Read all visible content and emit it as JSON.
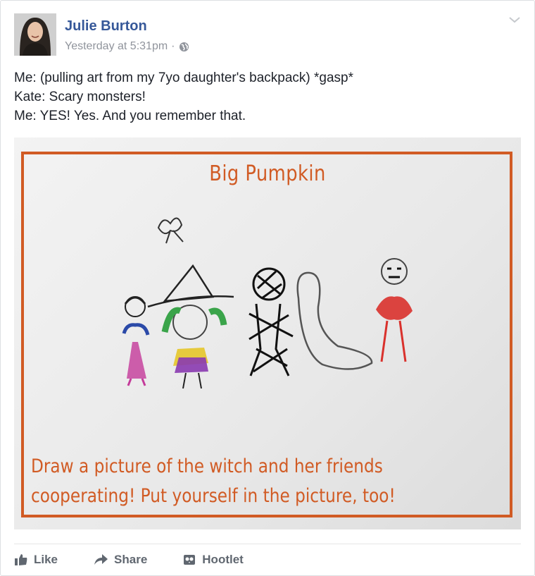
{
  "post": {
    "author": "Julie Burton",
    "timestamp": "Yesterday at 5:31pm",
    "separator": "·",
    "audience_icon": "globe-icon",
    "menu_icon": "chevron-down-icon",
    "lines": [
      "Me: (pulling art from my 7yo daughter's backpack) *gasp*",
      "Kate: Scary monsters!",
      "Me: YES! Yes. And you remember that."
    ]
  },
  "photo": {
    "title": "Big Pumpkin",
    "prompt_line1": "Draw a picture of the witch and her friends",
    "prompt_line2": "cooperating!  Put yourself in the picture, too!"
  },
  "actions": {
    "like_label": "Like",
    "share_label": "Share",
    "hootlet_label": "Hootlet"
  },
  "colors": {
    "author_link": "#365899",
    "meta_gray": "#90949c",
    "worksheet_orange": "#d15b24"
  }
}
